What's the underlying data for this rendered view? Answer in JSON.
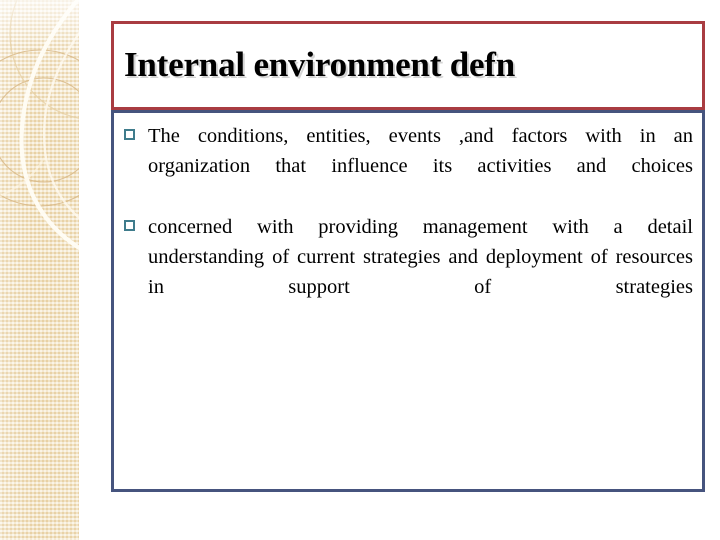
{
  "slide": {
    "title": "Internal environment defn",
    "title_border_color": "#a93c41",
    "body_border_color": "#46547e",
    "bullet_marker_color": "#3f7c8c",
    "sidebar_color": "#f0dfb9",
    "background_color": "#ffffff",
    "text_color": "#000000",
    "bullets": [
      {
        "marker": "hollow-square-bullet",
        "text": "The conditions, entities, events ,and factors with in an organization that influence its activities and choices"
      },
      {
        "marker": "hollow-square-bullet",
        "text": "concerned with providing management with a detail understanding of current strategies and deployment of resources in support of strategies"
      }
    ],
    "decoration": {
      "sidebar_art": "concentric-circles-swoosh",
      "texture": "woven-checker-texture"
    }
  }
}
